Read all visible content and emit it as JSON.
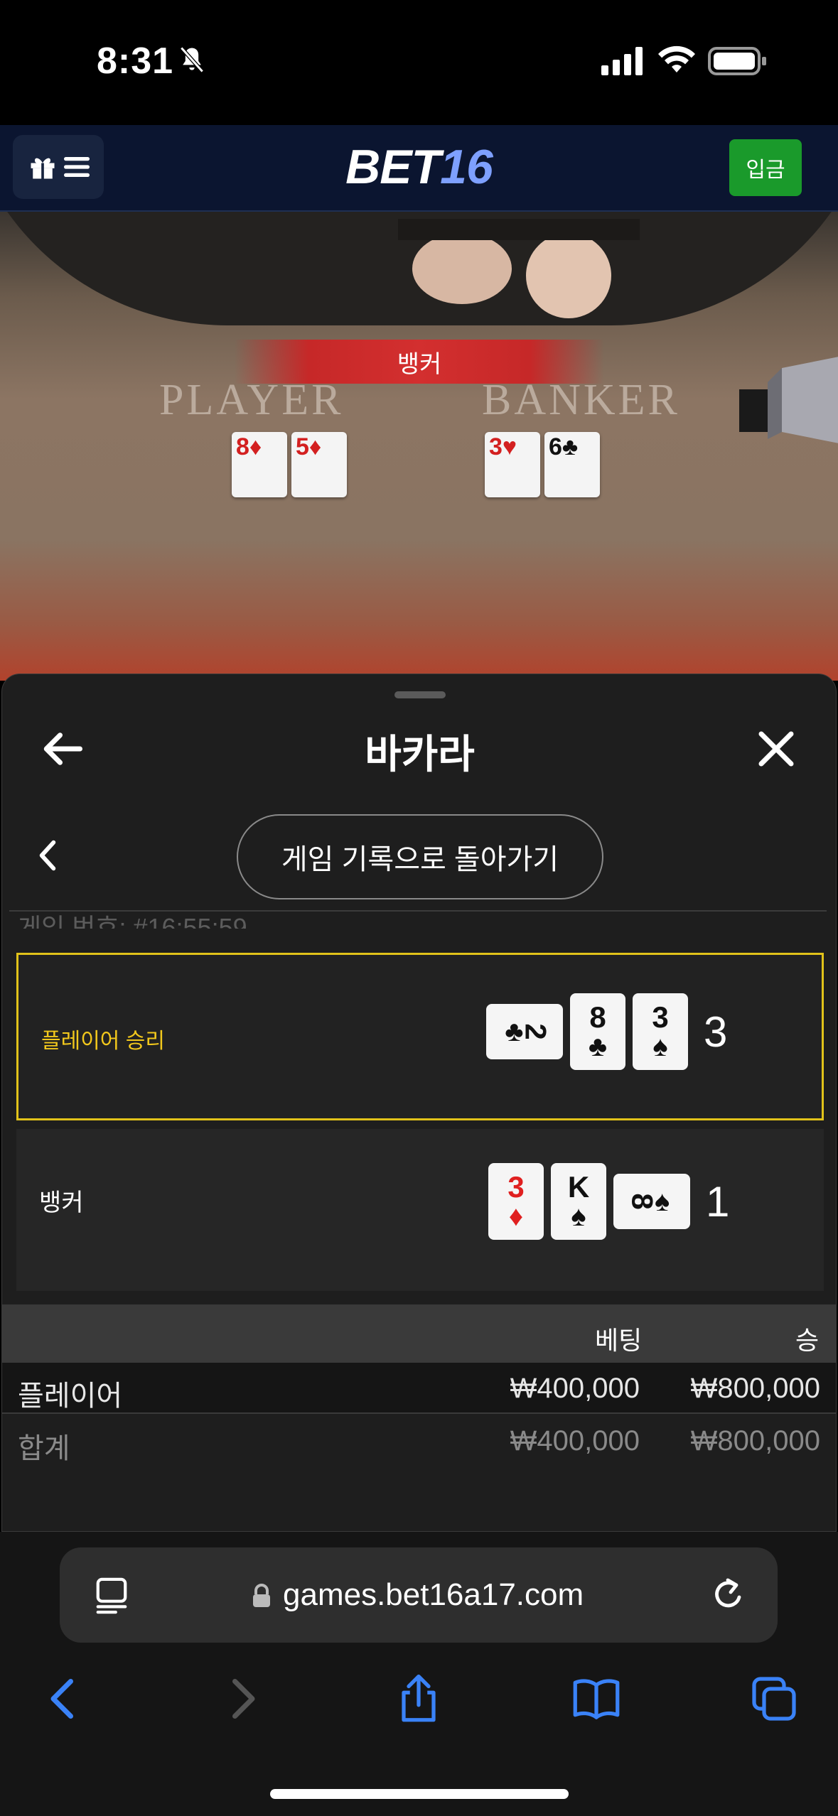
{
  "status_bar": {
    "time": "8:31"
  },
  "header": {
    "logo_part1": "BET",
    "logo_part2": "16",
    "deposit_label": "입금"
  },
  "video": {
    "banner_text": "뱅커",
    "player_label": "PLAYER",
    "banker_label": "BANKER",
    "player_cards": [
      {
        "rank": "8",
        "suit": "♦"
      },
      {
        "rank": "5",
        "suit": "♦"
      }
    ],
    "banker_cards": [
      {
        "rank": "3",
        "suit": "♥"
      },
      {
        "rank": "6",
        "suit": "♣"
      }
    ]
  },
  "sheet": {
    "title": "바카라",
    "history_button": "게임 기록으로 돌아가기",
    "game_number_partial": "게임 번호: #16:55:59",
    "player_row": {
      "label": "플레이어 승리",
      "cards": [
        {
          "rank": "2",
          "suit": "♣"
        },
        {
          "rank": "8",
          "suit": "♣"
        },
        {
          "rank": "3",
          "suit": "♠"
        }
      ],
      "score": "3"
    },
    "banker_row": {
      "label": "뱅커",
      "cards": [
        {
          "rank": "3",
          "suit": "♦"
        },
        {
          "rank": "K",
          "suit": "♠"
        },
        {
          "rank": "8",
          "suit": "♠"
        }
      ],
      "score": "1"
    },
    "bet_table": {
      "headers": {
        "bet": "베팅",
        "win": "승"
      },
      "rows": [
        {
          "name": "플레이어",
          "bet": "₩400,000",
          "win": "₩800,000"
        },
        {
          "name": "합계",
          "bet": "₩400,000",
          "win": "₩800,000"
        }
      ]
    }
  },
  "browser": {
    "url": "games.bet16a17.com"
  },
  "colors": {
    "accent_gold": "#e1c21a",
    "deposit_green": "#1a9a2b",
    "header_navy": "#0b1530",
    "ios_blue": "#3a82f7"
  }
}
